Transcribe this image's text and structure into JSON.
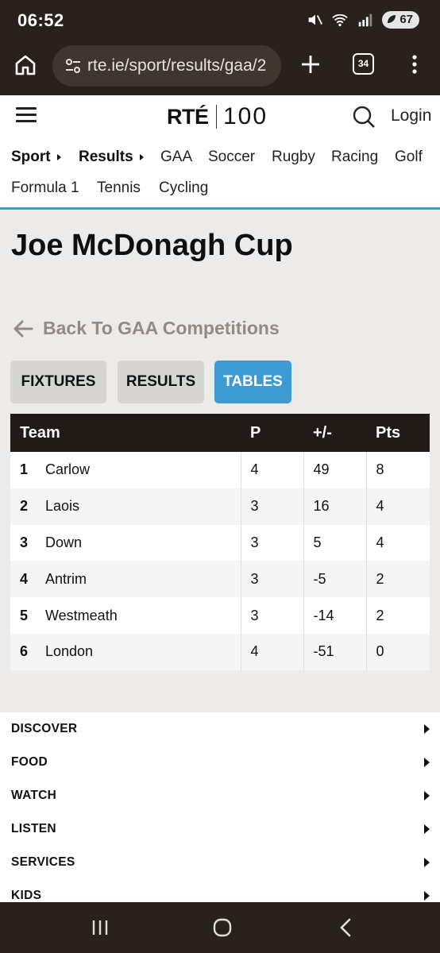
{
  "status_bar": {
    "time": "06:52",
    "battery": "67",
    "icons": [
      "mute-icon",
      "wifi-icon",
      "signal-icon",
      "battery-icon"
    ]
  },
  "browser": {
    "url": "rte.ie/sport/results/gaa/2",
    "tab_count": "34"
  },
  "header": {
    "logo_main": "RTÉ",
    "logo_suffix": "100",
    "login": "Login"
  },
  "sub_nav": {
    "row1": [
      {
        "label": "Sport",
        "caret": true
      },
      {
        "label": "Results",
        "caret": true
      },
      {
        "label": "GAA"
      },
      {
        "label": "Soccer"
      },
      {
        "label": "Rugby"
      },
      {
        "label": "Racing"
      },
      {
        "label": "Golf"
      }
    ],
    "row2": [
      {
        "label": "Formula 1"
      },
      {
        "label": "Tennis"
      },
      {
        "label": "Cycling"
      }
    ]
  },
  "page": {
    "title": "Joe McDonagh Cup",
    "back_link": "Back To GAA Competitions",
    "tabs": [
      "FIXTURES",
      "RESULTS",
      "TABLES"
    ],
    "active_tab": "TABLES"
  },
  "table": {
    "headers": [
      "Team",
      "P",
      "+/-",
      "Pts"
    ],
    "rows": [
      {
        "pos": "1",
        "team": "Carlow",
        "p": "4",
        "diff": "49",
        "pts": "8"
      },
      {
        "pos": "2",
        "team": "Laois",
        "p": "3",
        "diff": "16",
        "pts": "4"
      },
      {
        "pos": "3",
        "team": "Down",
        "p": "3",
        "diff": "5",
        "pts": "4"
      },
      {
        "pos": "4",
        "team": "Antrim",
        "p": "3",
        "diff": "-5",
        "pts": "2"
      },
      {
        "pos": "5",
        "team": "Westmeath",
        "p": "3",
        "diff": "-14",
        "pts": "2"
      },
      {
        "pos": "6",
        "team": "London",
        "p": "4",
        "diff": "-51",
        "pts": "0"
      }
    ]
  },
  "footer_menu": [
    "DISCOVER",
    "FOOD",
    "WATCH",
    "LISTEN",
    "SERVICES",
    "KIDS"
  ],
  "colors": {
    "accent": "#3d9bd2",
    "chrome": "#2b211c",
    "table_header": "#221a16"
  }
}
